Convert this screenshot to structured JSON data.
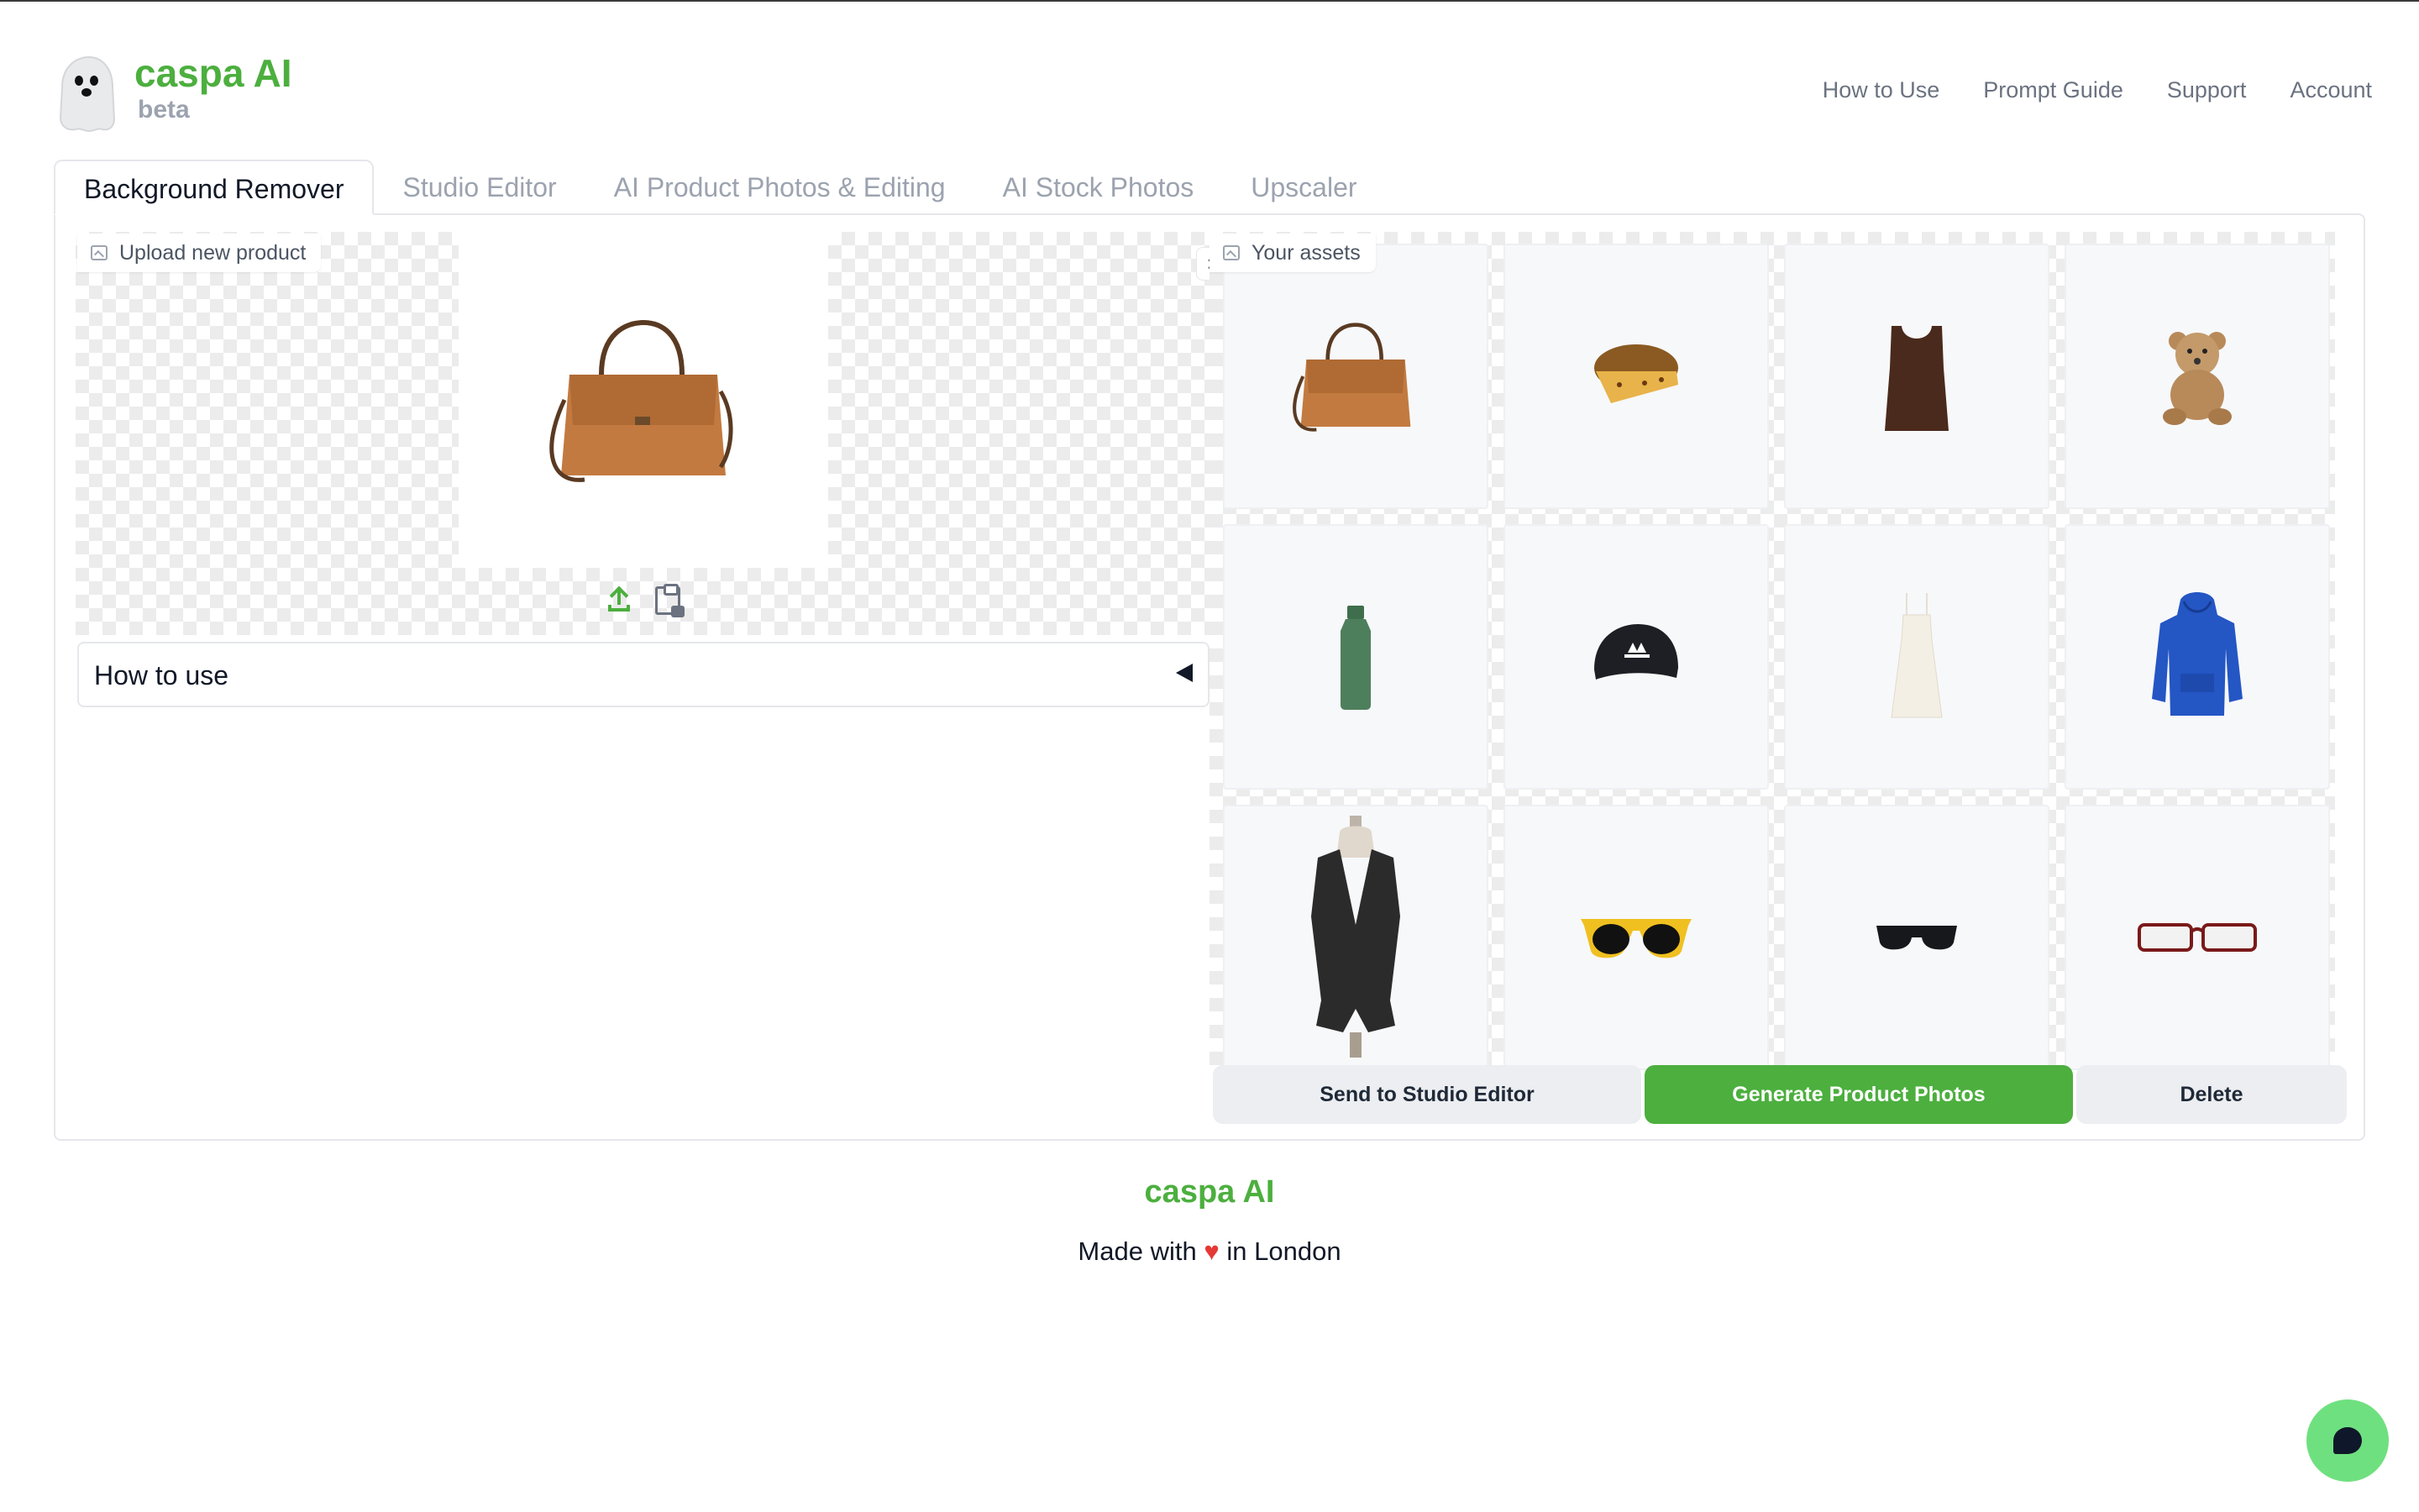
{
  "brand": {
    "name": "caspa AI",
    "tag": "beta"
  },
  "topnav": [
    "How to Use",
    "Prompt Guide",
    "Support",
    "Account"
  ],
  "tabs": [
    "Background Remover",
    "Studio Editor",
    "AI Product Photos & Editing",
    "AI Stock Photos",
    "Upscaler"
  ],
  "upload": {
    "label": "Upload new product",
    "close": "×"
  },
  "howto": {
    "label": "How to use"
  },
  "assets": {
    "label": "Your assets",
    "items": [
      "handbag",
      "panettone",
      "tank-top",
      "teddy-bear",
      "water-bottle",
      "baseball-cap",
      "slip-dress",
      "blue-hoodie",
      "black-vest",
      "yellow-sunglasses",
      "black-sunglasses",
      "red-glasses"
    ]
  },
  "buttons": {
    "send": "Send to Studio Editor",
    "generate": "Generate Product Photos",
    "delete": "Delete"
  },
  "footer": {
    "brand": "caspa AI",
    "made_prefix": "Made with",
    "heart": "♥",
    "made_suffix": "in London"
  },
  "colors": {
    "accent": "#4caf3e",
    "chat": "#6fe07f"
  }
}
